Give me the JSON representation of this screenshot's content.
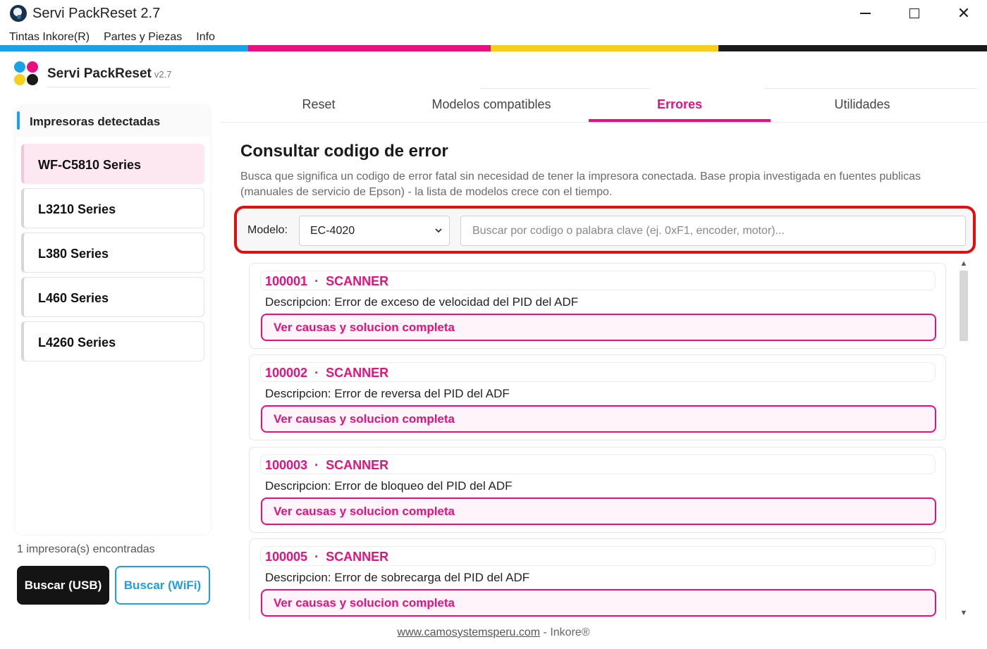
{
  "window": {
    "title": "Servi PackReset 2.7",
    "min_glyph": "",
    "close_glyph": "✕"
  },
  "menu": [
    "Tintas Inkore(R)",
    "Partes y Piezas",
    "Info"
  ],
  "stripe_colors": [
    "#1aa1e8",
    "#e8107c",
    "#f5cf1c",
    "#1a1a1a"
  ],
  "brand": {
    "name": "Servi PackReset",
    "version": "v2.7",
    "dot_colors": [
      "#1aa1e8",
      "#e8107c",
      "#f5cf1c",
      "#1a1a1a"
    ]
  },
  "sidebar": {
    "header": "Impresoras detectadas",
    "accent": "#1aa1e8",
    "printers": [
      {
        "label": "WF-C5810 Series",
        "selected": true
      },
      {
        "label": "L3210 Series",
        "selected": false
      },
      {
        "label": "L380 Series",
        "selected": false
      },
      {
        "label": "L460 Series",
        "selected": false
      },
      {
        "label": "L4260 Series",
        "selected": false
      }
    ],
    "found_text": "1 impresora(s) encontradas",
    "btn_usb": "Buscar (USB)",
    "btn_wifi": "Buscar (WiFi)"
  },
  "tabs": {
    "items": [
      "Reset",
      "Modelos compatibles",
      "Errores",
      "Utilidades"
    ],
    "active": "Errores",
    "accent": "#e8107c"
  },
  "main": {
    "title": "Consultar codigo de error",
    "description": "Busca que significa un codigo de error fatal sin necesidad de tener la impresora conectada. Base propia investigada en fuentes publicas (manuales de servicio de Epson) - la lista de modelos crece con el tiempo.",
    "filter": {
      "model_label": "Modelo:",
      "model_value": "EC-4020",
      "search_placeholder": "Buscar por codigo o palabra clave (ej. 0xF1, encoder, motor)...",
      "highlight_color": "#e01010"
    },
    "errors": [
      {
        "code": "100001",
        "category": "SCANNER",
        "description": "Descripcion: Error de exceso de velocidad del PID del ADF",
        "action": "Ver causas y solucion completa"
      },
      {
        "code": "100002",
        "category": "SCANNER",
        "description": "Descripcion: Error de reversa del PID del ADF",
        "action": "Ver causas y solucion completa"
      },
      {
        "code": "100003",
        "category": "SCANNER",
        "description": "Descripcion: Error de bloqueo del PID del ADF",
        "action": "Ver causas y solucion completa"
      },
      {
        "code": "100005",
        "category": "SCANNER",
        "description": "Descripcion: Error de sobrecarga del PID del ADF",
        "action": "Ver causas y solucion completa"
      }
    ],
    "separator": "·"
  },
  "footer": {
    "link": "www.camosystemsperu.com",
    "suffix": " - Inkore®"
  }
}
